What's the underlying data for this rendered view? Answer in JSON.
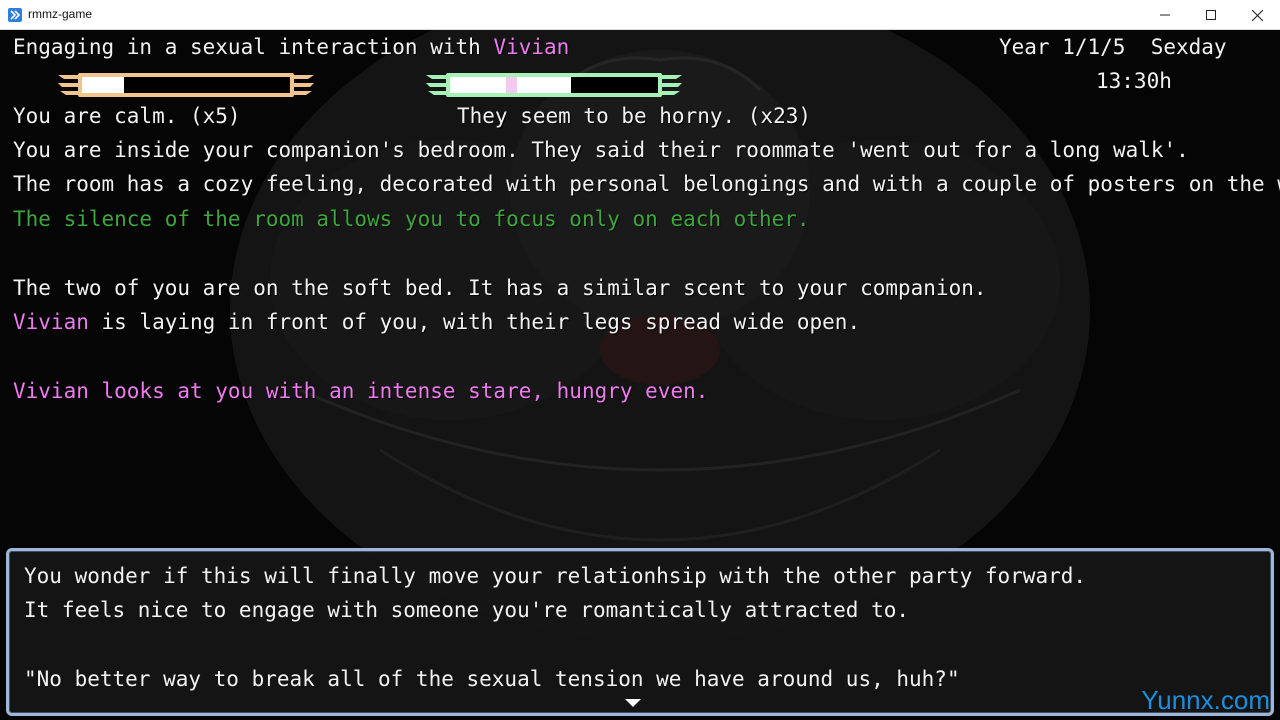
{
  "window": {
    "title": "rmmz-game"
  },
  "header": {
    "interaction_prefix": "Engaging in a sexual interaction with ",
    "partner_name": "Vivian",
    "date": "Year 1/1/5  Sexday",
    "time": "13:30h"
  },
  "bars": {
    "player": {
      "fill": 0.2,
      "color": "#f2c48e"
    },
    "partner": {
      "fill": 0.58,
      "pink_from": 0.27,
      "color": "#a6f2b6"
    }
  },
  "status": {
    "player": "You are calm. (x5)",
    "partner": "They seem to be horny. (x23)"
  },
  "narration": {
    "line1": "You are inside your companion's bedroom. They said their roommate 'went out for a long walk'.",
    "line2": "The room has a cozy feeling, decorated with personal belongings and with a couple of posters on the walls.",
    "line3": "The silence of the room allows you to focus only on each other.",
    "line4": "The two of you are on the soft bed. It has a similar scent to your companion.",
    "line5_name": "Vivian",
    "line5_rest": " is laying in front of you, with their legs spread wide open.",
    "line6": "Vivian looks at you with an intense stare, hungry even."
  },
  "message": {
    "line1": "You wonder if this will finally move your relationhsip with the other party forward.",
    "line2": "It feels nice to engage with someone you're romantically attracted to.",
    "line3": "\"No better way to break all of the sexual tension we have around us, huh?\""
  },
  "watermark": "Yunnx.com",
  "colors": {
    "pink_text": "#f07bf0",
    "green_text": "#3aa83a",
    "message_border": "#9fb7d6"
  }
}
